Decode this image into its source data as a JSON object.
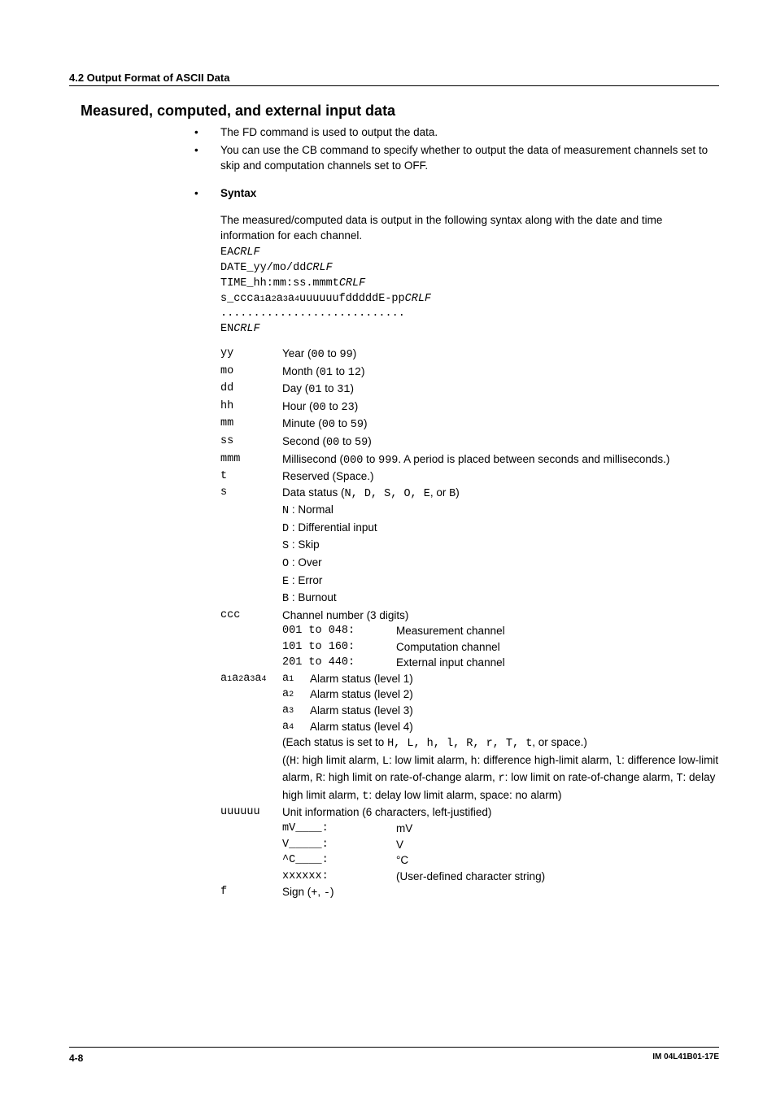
{
  "header": {
    "section": "4.2  Output Format of ASCII Data"
  },
  "title": "Measured, computed, and external input data",
  "bullets": [
    "The FD command is used to output the data.",
    "You can use the CB command to specify whether to output the data of measurement channels set to skip and computation channels set to OFF."
  ],
  "syntax": {
    "heading": "Syntax",
    "intro": "The measured/computed data is output in the following syntax along with the date and time information for each channel.",
    "lines": {
      "l1a": "EA",
      "l1b": "CRLF",
      "l2a": "DATE_yy/mo/dd",
      "l2b": "CRLF",
      "l3a": "TIME_hh:mm:ss.mmmt",
      "l3b": "CRLF",
      "l4a": "s_ccca",
      "l4s1": "1",
      "l4b": "a",
      "l4s2": "2",
      "l4c": "a",
      "l4s3": "3",
      "l4d": "a",
      "l4s4": "4",
      "l4e": "uuuuuufdddddE-pp",
      "l4f": "CRLF",
      "l5": "............................",
      "l6a": "EN",
      "l6b": "CRLF"
    }
  },
  "defs": {
    "yy": {
      "sym": "yy",
      "pre": "Year (",
      "code": "00",
      "mid": " to ",
      "code2": "99",
      "post": ")"
    },
    "mo": {
      "sym": "mo",
      "pre": "Month (",
      "code": "01",
      "mid": " to ",
      "code2": "12",
      "post": ")"
    },
    "dd": {
      "sym": "dd",
      "pre": "Day (",
      "code": "01",
      "mid": " to ",
      "code2": "31",
      "post": ")"
    },
    "hh": {
      "sym": "hh",
      "pre": "Hour (",
      "code": "00",
      "mid": " to ",
      "code2": "23",
      "post": ")"
    },
    "mm": {
      "sym": "mm",
      "pre": "Minute (",
      "code": "00",
      "mid": " to ",
      "code2": "59",
      "post": ")"
    },
    "ss": {
      "sym": "ss",
      "pre": "Second (",
      "code": "00",
      "mid": " to ",
      "code2": "59",
      "post": ")"
    },
    "mmm": {
      "sym": "mmm",
      "pre": "Millisecond (",
      "code": "000",
      "mid": " to ",
      "code2": "999",
      "post": ".  A period is placed between seconds and milliseconds.)"
    },
    "t": {
      "sym": "t",
      "txt": "Reserved (Space.)"
    },
    "s": {
      "sym": "s",
      "pre": "Data status (",
      "codes": "N, D, S, O, E",
      "mid": ", or ",
      "codeb": "B",
      "post": ")",
      "items": [
        {
          "k": "N",
          "v": "Normal"
        },
        {
          "k": "D",
          "v": "Differential input"
        },
        {
          "k": "S",
          "v": "Skip"
        },
        {
          "k": "O",
          "v": "Over"
        },
        {
          "k": "E",
          "v": "Error"
        },
        {
          "k": "B",
          "v": "Burnout"
        }
      ]
    },
    "ccc": {
      "sym": "ccc",
      "txt": "Channel number (3 digits)",
      "ranges": [
        {
          "a": "001",
          "b": "048",
          "v": "Measurement channel"
        },
        {
          "a": "101",
          "b": "160",
          "v": "Computation channel"
        },
        {
          "a": "201",
          "b": "440",
          "v": "External input channel"
        }
      ]
    },
    "alarm": {
      "symPre": "a",
      "s1": "1",
      "s2": "2",
      "s3": "3",
      "s4": "4",
      "levels": [
        {
          "k": "a",
          "s": "1",
          "v": "Alarm status (level 1)"
        },
        {
          "k": "a",
          "s": "2",
          "v": "Alarm status (level 2)"
        },
        {
          "k": "a",
          "s": "3",
          "v": "Alarm status (level 3)"
        },
        {
          "k": "a",
          "s": "4",
          "v": "Alarm status (level 4)"
        }
      ],
      "note1_pre": "(Each status is set to ",
      "note1_codes": "H, L, h, l, R, r, T, t",
      "note1_post": ", or space.)",
      "note2_a": "((",
      "note2_H": "H",
      "note2_b": ": high limit alarm, ",
      "note2_L": "L",
      "note2_c": ": low limit alarm, ",
      "note2_h": "h",
      "note2_d": ": difference high-limit alarm, ",
      "note2_l": "l",
      "note2_e": ": difference low-limit alarm, ",
      "note2_R": "R",
      "note2_f": ": high limit on rate-of-change alarm, ",
      "note2_r": "r",
      "note2_g": ": low limit on rate-of-change alarm, ",
      "note2_T": "T",
      "note2_hh": ": delay high limit alarm, ",
      "note2_t": "t",
      "note2_i": ": delay low limit alarm, space: no alarm)"
    },
    "uuu": {
      "sym": "uuuuuu",
      "txt": "Unit information (6 characters, left-justified)",
      "units": [
        {
          "k": "mV____:",
          "v": "mV"
        },
        {
          "k": "V_____:",
          "v": "V"
        },
        {
          "k": "^C____:",
          "v": "°C"
        },
        {
          "k": "xxxxxx:",
          "v": "(User-defined character string)"
        }
      ]
    },
    "f": {
      "sym": "f",
      "pre": "Sign (",
      "code": "+",
      "mid": ", ",
      "code2": "-",
      "post": ")"
    }
  },
  "footer": {
    "page": "4-8",
    "doc": "IM 04L41B01-17E"
  }
}
